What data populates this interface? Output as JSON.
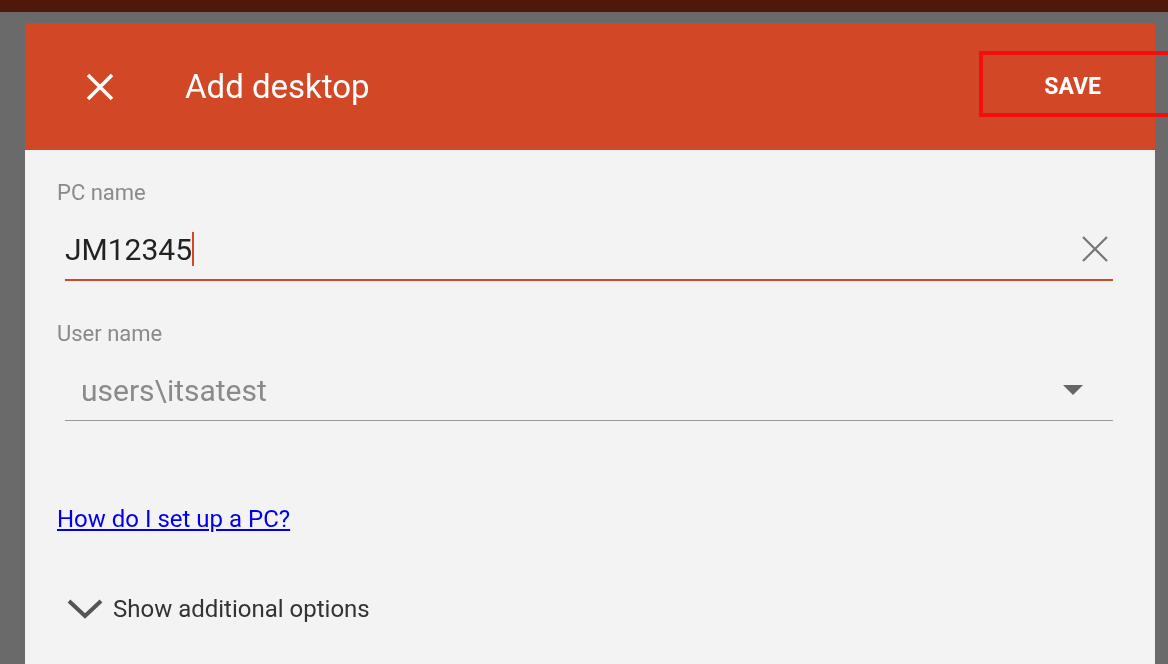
{
  "dialog": {
    "title": "Add desktop",
    "save_label": "SAVE"
  },
  "fields": [
    {
      "kind": "text",
      "label": "PC name",
      "value": "JM12345",
      "focused": true
    },
    {
      "kind": "dropdown",
      "label": "User name",
      "value": "users\\itsatest",
      "focused": false
    }
  ],
  "help_link": "How do I set up a PC?",
  "options_toggle": {
    "label": "Show additional options",
    "expanded": false
  }
}
